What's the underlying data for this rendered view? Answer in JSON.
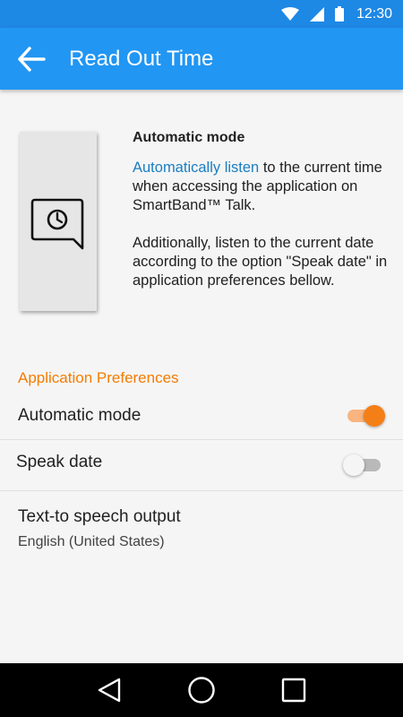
{
  "status_bar": {
    "time": "12:30",
    "icons": [
      "wifi-icon",
      "signal-icon",
      "battery-icon"
    ]
  },
  "app_bar": {
    "title": "Read Out Time",
    "back_icon": "arrow-back-icon"
  },
  "info": {
    "title": "Automatic mode",
    "para1_link": "Automatically listen",
    "para1_rest": " to the current time when accessing the application on SmartBand™ Talk.",
    "para2": "Additionally, listen to the current date according to the option \"Speak date\" in application preferences bellow.",
    "illustration_icon": "clock-chat-bubble-icon"
  },
  "preferences": {
    "section_title": "Application Preferences",
    "automatic_mode": {
      "label": "Automatic mode",
      "enabled": true
    },
    "speak_date": {
      "label": "Speak date",
      "enabled": false
    },
    "tts": {
      "title": "Text-to speech output",
      "value": "English (United States)"
    }
  },
  "nav_bar": {
    "icons": [
      "back-triangle-icon",
      "home-circle-icon",
      "recents-square-icon"
    ]
  },
  "colors": {
    "status_bar": "#1e88e5",
    "app_bar": "#2196f3",
    "accent": "#f57c00",
    "link": "#1a7ec1",
    "background": "#f5f5f5"
  }
}
